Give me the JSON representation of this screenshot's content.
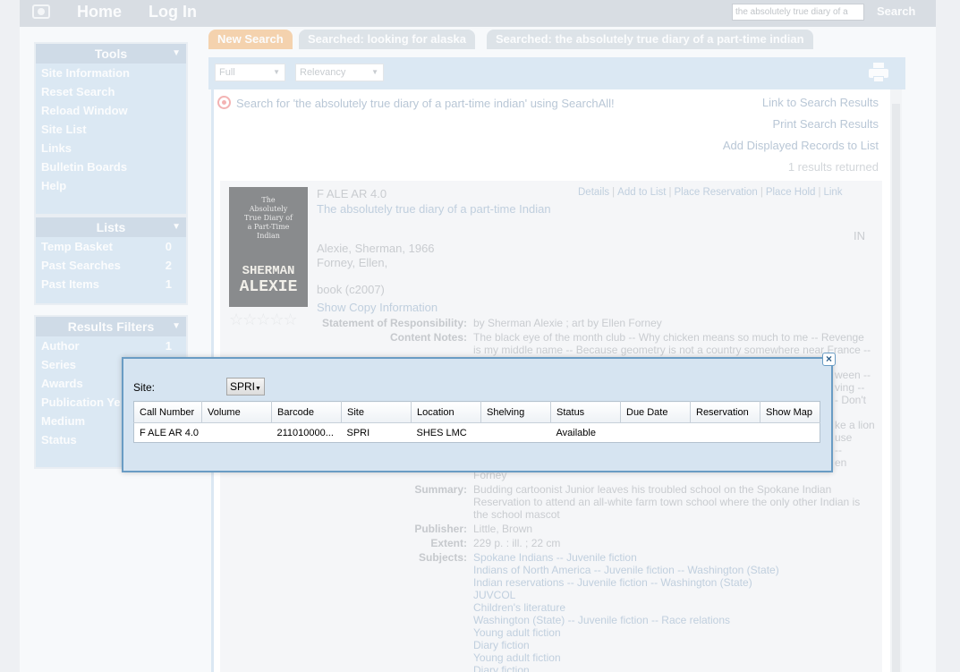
{
  "topbar": {
    "nav": [
      "Home",
      "Log In"
    ],
    "search_value": "the absolutely true diary of a",
    "search_button": "Search"
  },
  "sidebar": {
    "tools": {
      "title": "Tools",
      "items": [
        "Site Information",
        "Reset Search",
        "Reload Window",
        "Site List",
        "Links",
        "Bulletin Boards",
        "Help"
      ]
    },
    "lists": {
      "title": "Lists",
      "items": [
        {
          "label": "Temp Basket",
          "count": "0"
        },
        {
          "label": "Past Searches",
          "count": "2"
        },
        {
          "label": "Past Items",
          "count": "1"
        }
      ]
    },
    "filters": {
      "title": "Results Filters",
      "items": [
        {
          "label": "Author",
          "count": "1"
        },
        {
          "label": "Series",
          "count": ""
        },
        {
          "label": "Awards",
          "count": ""
        },
        {
          "label": "Publication Ye",
          "count": ""
        },
        {
          "label": "Medium",
          "count": ""
        },
        {
          "label": "Status",
          "count": ""
        }
      ]
    }
  },
  "tabs": [
    "New Search",
    "Searched: looking for alaska",
    "Searched: the absolutely true diary of a part-time indian"
  ],
  "toolbar": {
    "view": "Full",
    "sort": "Relevancy"
  },
  "results": {
    "searchall": "Search for 'the absolutely true diary of a part-time indian' using SearchAll!",
    "links": [
      "Link to Search Results",
      "Print Search Results",
      "Add Displayed Records to List"
    ],
    "count": "1 results returned"
  },
  "record": {
    "cover_title": "The Absolutely True Diary of a Part-Time Indian",
    "cover_author_first": "SHERMAN",
    "cover_author_last": "ALEXIE",
    "call_number": "F ALE AR 4.0",
    "title": "The absolutely true diary of a part-time Indian",
    "actions": [
      "Details",
      "Add to List",
      "Place Reservation",
      "Place Hold",
      "Link"
    ],
    "status": "IN",
    "author": "Alexie, Sherman, 1966",
    "illustrator": "Forney, Ellen,",
    "format": "book   (c2007)",
    "show_copy": "Show Copy Information",
    "fields": {
      "responsibility_label": "Statement of Responsibility:",
      "responsibility": "by Sherman Alexie ; art by Ellen Forney",
      "content_label": "Content Notes:",
      "content_1": "The black eye of the month club -- Why chicken means so much to me -- Revenge",
      "content_2": "is my middle name -- Because geometry is not a country somewhere near France --",
      "frag_ween": "ween --",
      "frag_ving": "ving --",
      "frag_dont": "- Don't",
      "frag_lion": "ke a lion",
      "frag_use": "use",
      "frag_dash": "--",
      "frag_en": "en",
      "forney": "Forney",
      "summary_label": "Summary:",
      "summary": "Budding cartoonist Junior leaves his troubled school on the Spokane Indian Reservation to attend an all-white farm town school where the only other Indian is the school mascot",
      "publisher_label": "Publisher:",
      "publisher": "Little, Brown",
      "extent_label": "Extent:",
      "extent": "229 p. : ill. ; 22 cm",
      "subjects_label": "Subjects:",
      "subjects": [
        "Spokane Indians -- Juvenile fiction",
        "Indians of North America -- Juvenile fiction -- Washington (State)",
        "Indian reservations -- Juvenile fiction -- Washington (State)",
        "JUVCOL",
        "Children's literature",
        "Washington (State) -- Juvenile fiction -- Race relations",
        "Young adult fiction",
        "Diary fiction",
        "Young adult fiction",
        "Diary fiction"
      ]
    }
  },
  "modal": {
    "site_label": "Site:",
    "site_value": "SPRI",
    "columns": [
      "Call Number",
      "Volume",
      "Barcode",
      "Site",
      "Location",
      "Shelving",
      "Status",
      "Due Date",
      "Reservation",
      "Show Map"
    ],
    "rows": [
      [
        "F ALE AR 4.0",
        "",
        "211010000...",
        "SPRI",
        "SHES LMC",
        "",
        "Available",
        "",
        "",
        ""
      ]
    ]
  }
}
